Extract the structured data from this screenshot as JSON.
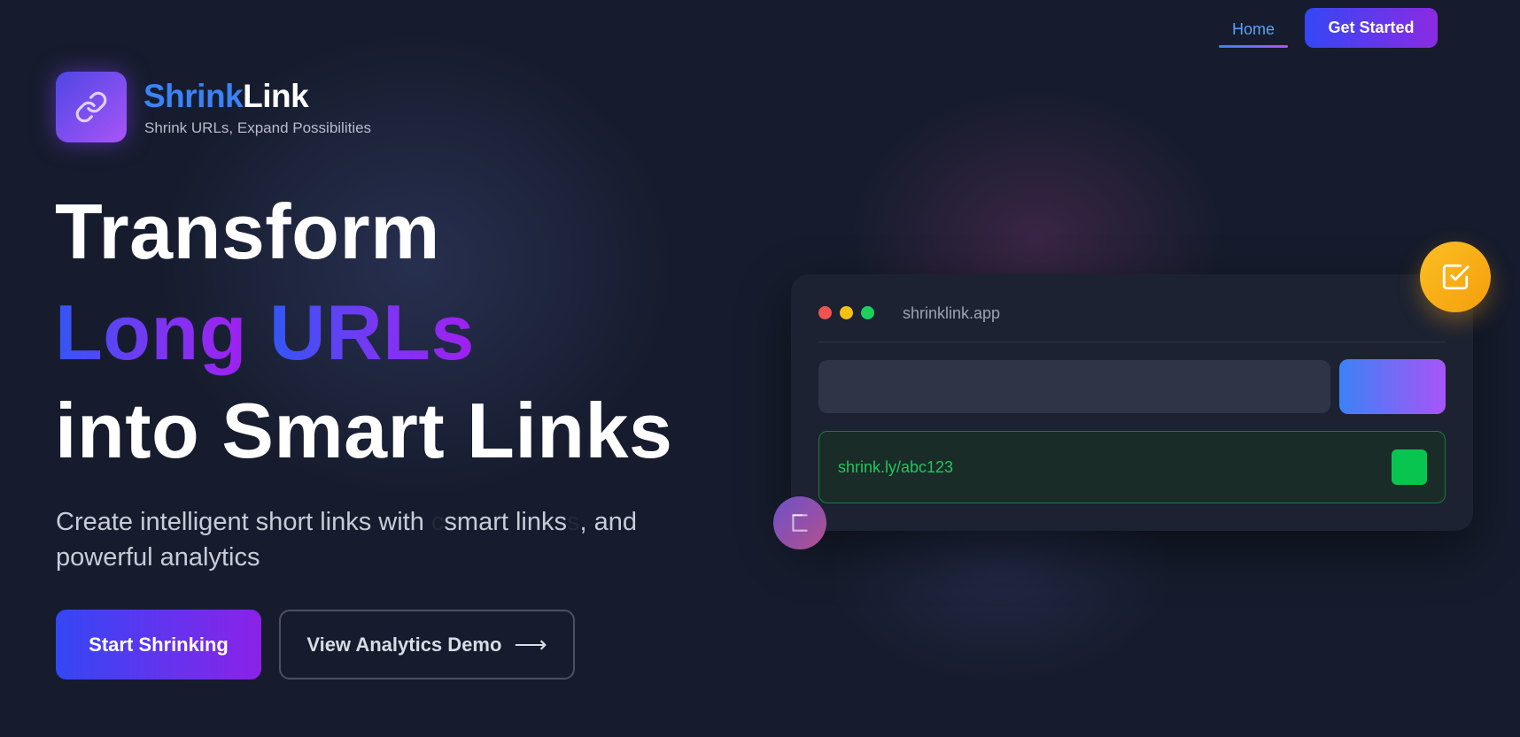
{
  "nav": {
    "home_label": "Home",
    "cta_label": "Get Started"
  },
  "brand": {
    "name_part1": "Shrink",
    "name_part2": "Link",
    "tagline": "Shrink URLs, Expand Possibilities",
    "logo_icon": "link-icon"
  },
  "hero": {
    "line1": "Transform",
    "line2_word1": "Long",
    "line2_word2": "URLs",
    "line3": "into Smart Links",
    "sub_before": "Create intelligent short links with ",
    "sub_faded_before": "c",
    "sub_highlight": "smart links",
    "sub_faded_after": "s",
    "sub_after": ", and",
    "sub_line2": "powerful analytics"
  },
  "buttons": {
    "primary_label": "Start Shrinking",
    "secondary_label": "View Analytics Demo",
    "secondary_arrow": "⟶"
  },
  "mock": {
    "url": "shrinklink.app",
    "result": "shrink.ly/abc123"
  },
  "floating": {
    "check_icon": "check-square-icon",
    "copy_icon": "copy-icon"
  },
  "colors": {
    "background": "#161c2d",
    "accent_blue": "#3b82f6",
    "accent_purple": "#a855f7",
    "success_green": "#22c55e",
    "amber": "#f59e0b"
  }
}
